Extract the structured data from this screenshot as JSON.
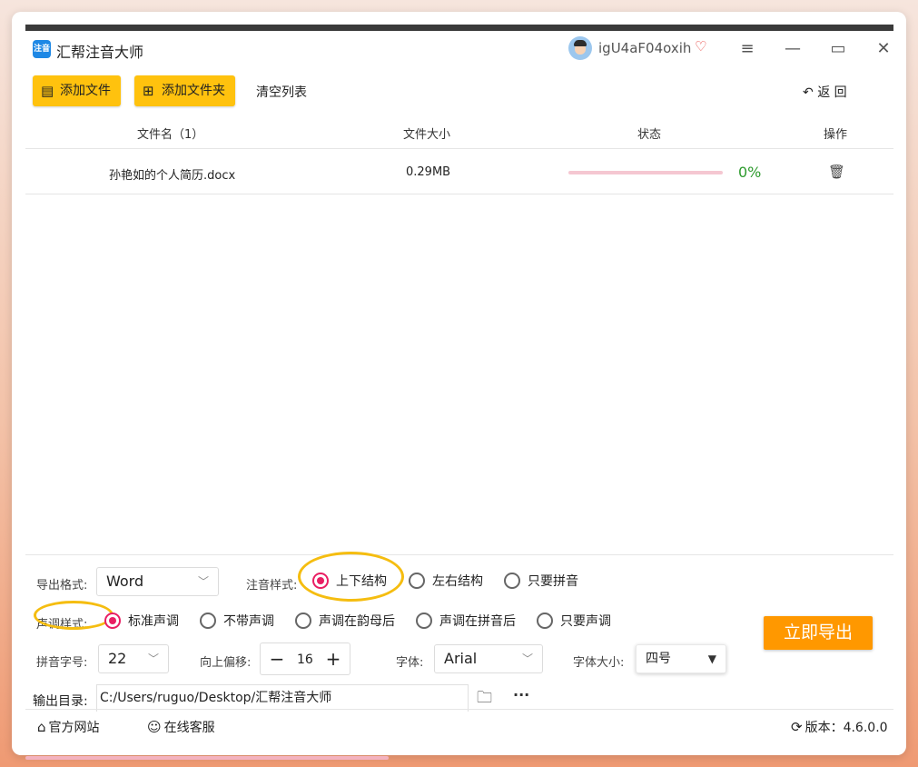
{
  "app": {
    "title": "汇帮注音大师",
    "logo_text": "注音"
  },
  "user": {
    "name": "igU4aF04oxih"
  },
  "toolbar": {
    "add_file": "添加文件",
    "add_folder": "添加文件夹",
    "clear_list": "清空列表",
    "back": "返 回"
  },
  "table": {
    "headers": {
      "name": "文件名（1）",
      "size": "文件大小",
      "status": "状态",
      "action": "操作"
    },
    "rows": [
      {
        "name": "孙艳如的个人简历.docx",
        "size": "0.29MB",
        "progress": "0%"
      }
    ]
  },
  "options": {
    "export_format_label": "导出格式:",
    "export_format_value": "Word",
    "pinyin_style_label": "注音样式:",
    "pinyin_styles": [
      "上下结构",
      "左右结构",
      "只要拼音"
    ],
    "tone_style_label": "声调样式:",
    "tone_styles": [
      "标准声调",
      "不带声调",
      "声调在韵母后",
      "声调在拼音后",
      "只要声调"
    ],
    "pinyin_size_label": "拼音字号:",
    "pinyin_size_value": "22",
    "offset_label": "向上偏移:",
    "offset_value": "16",
    "font_label": "字体:",
    "font_value": "Arial",
    "font_size_label": "字体大小:",
    "font_size_value": "四号",
    "output_dir_label": "输出目录:",
    "output_dir_value": "C:/Users/ruguo/Desktop/汇帮注音大师",
    "export_button": "立即导出"
  },
  "footer": {
    "website": "官方网站",
    "support": "在线客服",
    "version": "版本：4.6.0.0"
  }
}
